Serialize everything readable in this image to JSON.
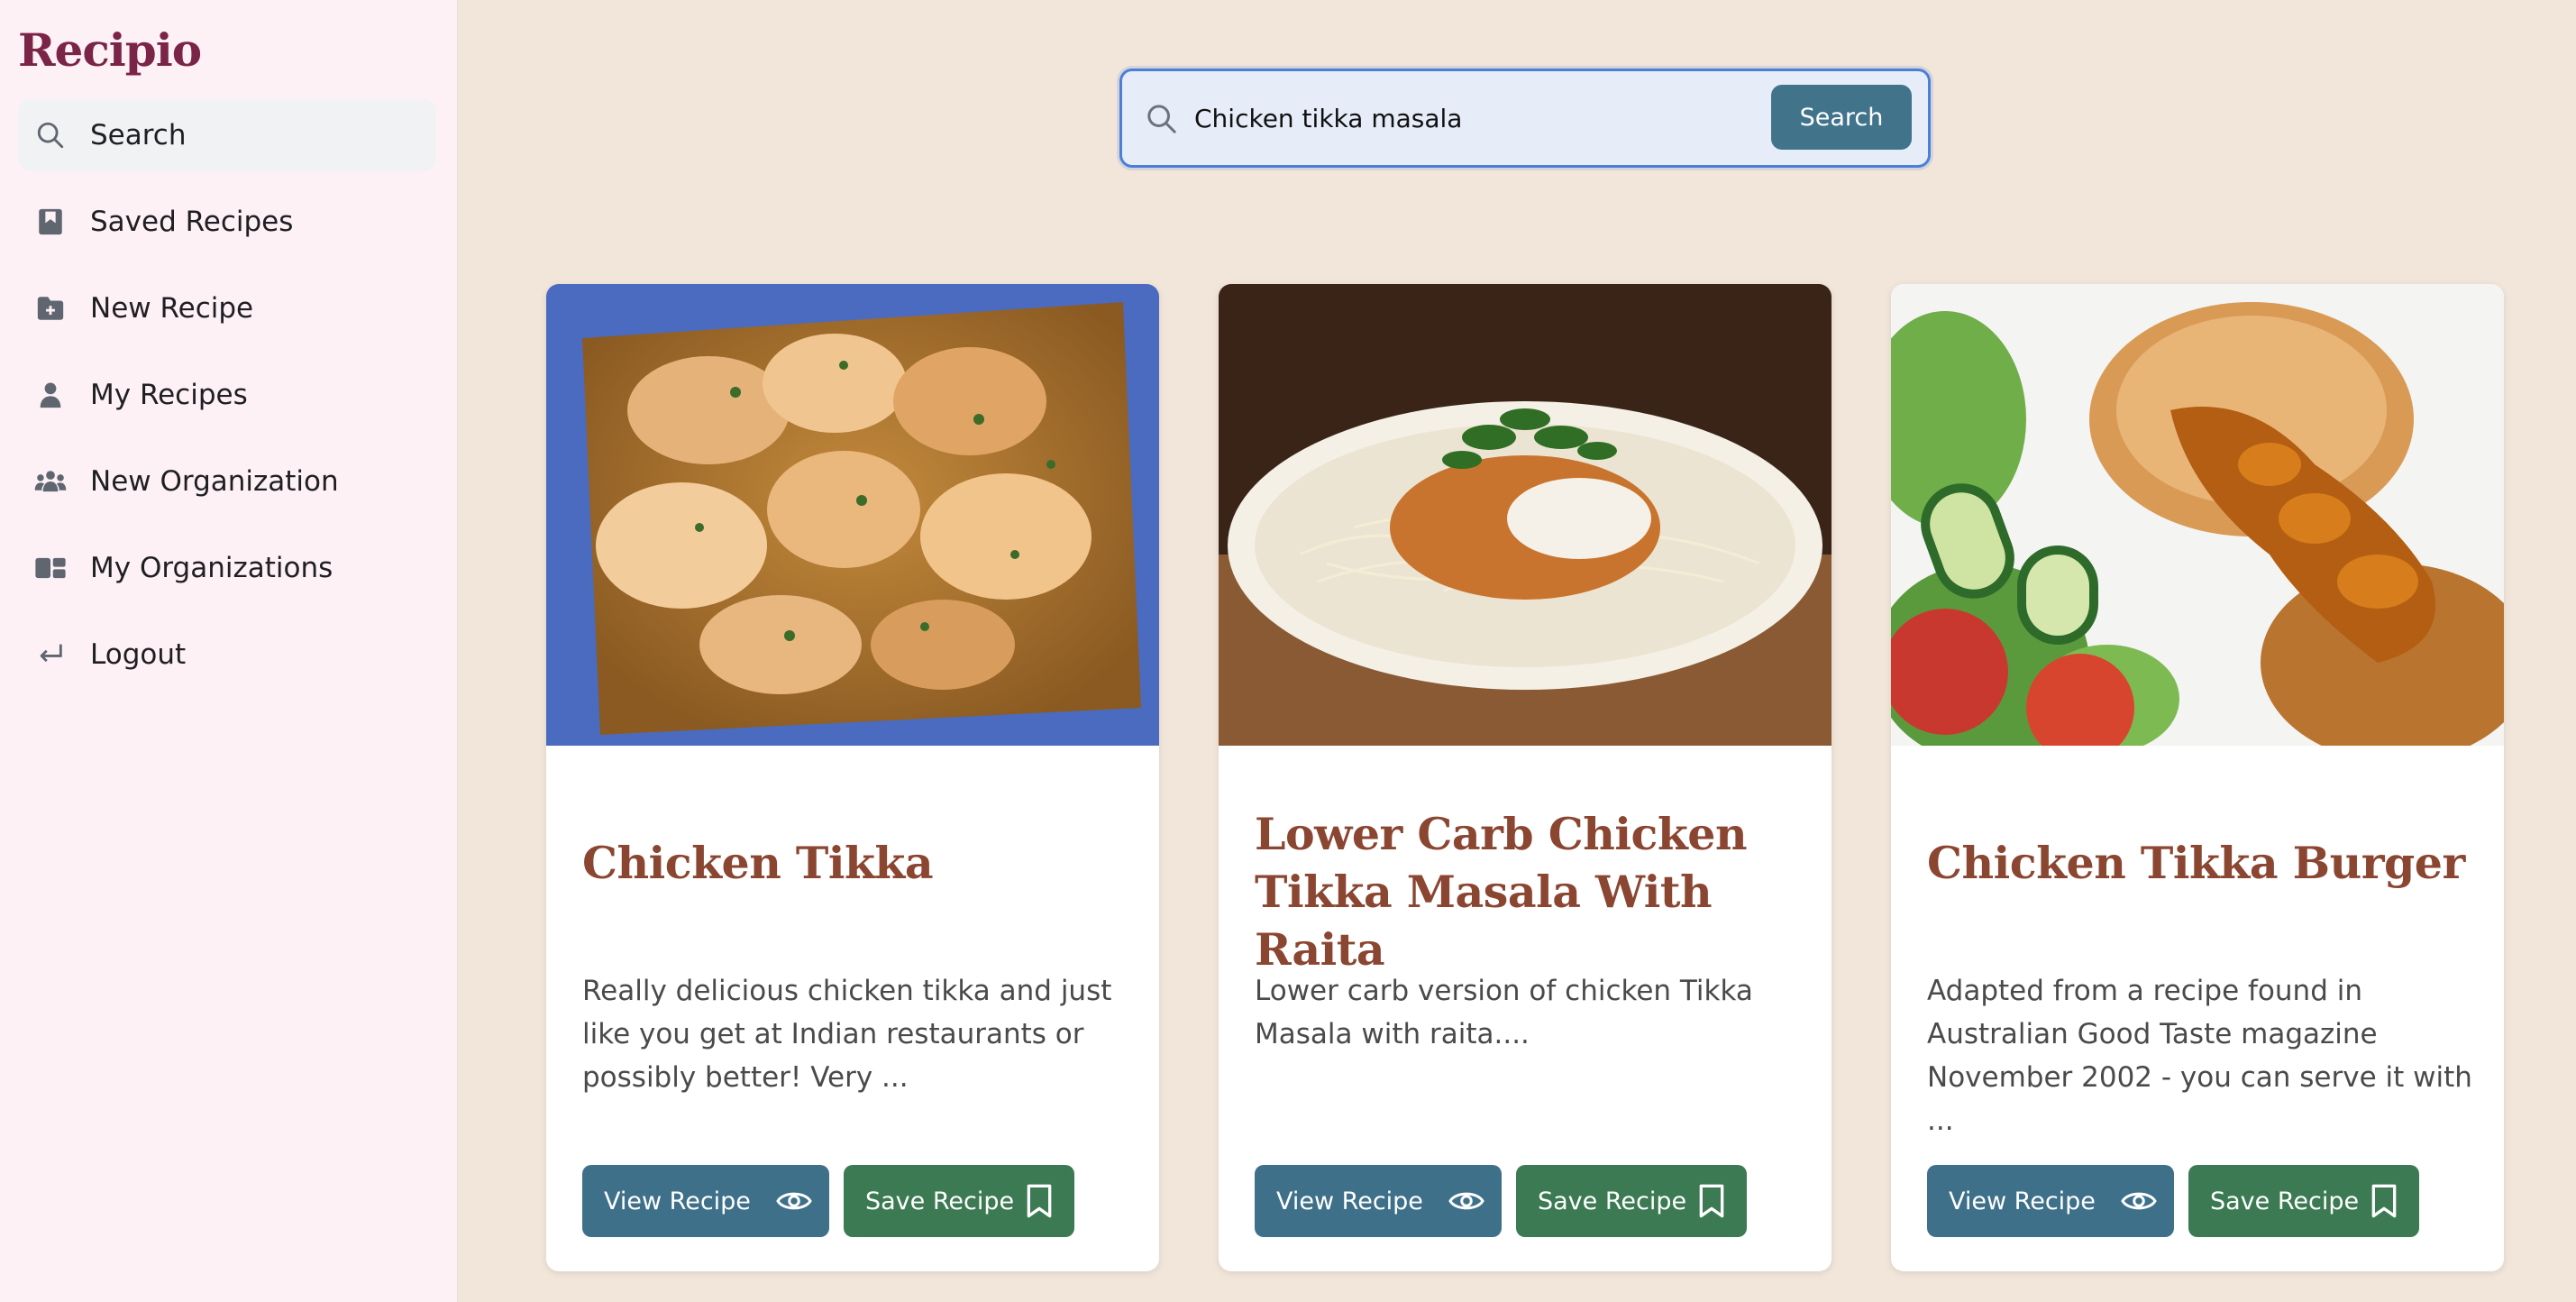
{
  "app": {
    "name": "Recipio"
  },
  "sidebar": {
    "items": [
      {
        "label": "Search",
        "icon": "search-icon",
        "active": true
      },
      {
        "label": "Saved Recipes",
        "icon": "bookmark-book-icon"
      },
      {
        "label": "New Recipe",
        "icon": "folder-plus-icon"
      },
      {
        "label": "My Recipes",
        "icon": "person-icon"
      },
      {
        "label": "New Organization",
        "icon": "people-group-icon"
      },
      {
        "label": "My Organizations",
        "icon": "organizations-icon"
      },
      {
        "label": "Logout",
        "icon": "logout-arrow-icon"
      }
    ]
  },
  "search": {
    "value": "Chicken tikka masala",
    "button_label": "Search"
  },
  "colors": {
    "accent": "#41738b",
    "save": "#3b7a52",
    "title": "#8b4632",
    "brand": "#7a2447",
    "background": "#f2e6da",
    "sidebar": "#fdf1f5"
  },
  "recipes": [
    {
      "title": "Chicken Tikka",
      "description": "Really delicious chicken tikka and just like you get at Indian restaurants or possibly better! Very ...",
      "view_label": "View Recipe",
      "save_label": "Save Recipe",
      "image_alt": "chicken tikka in a blue dish"
    },
    {
      "title": "Lower Carb Chicken Tikka Masala With Raita",
      "description": "Lower carb version of chicken Tikka Masala with raita....",
      "view_label": "View Recipe",
      "save_label": "Save Recipe",
      "image_alt": "chicken tikka masala on bean sprouts"
    },
    {
      "title": "Chicken Tikka Burger",
      "description": "Adapted from a recipe found in Australian Good Taste magazine November 2002 - you can serve it with ...",
      "view_label": "View Recipe",
      "save_label": "Save Recipe",
      "image_alt": "chicken tikka burger patty with salad"
    }
  ]
}
